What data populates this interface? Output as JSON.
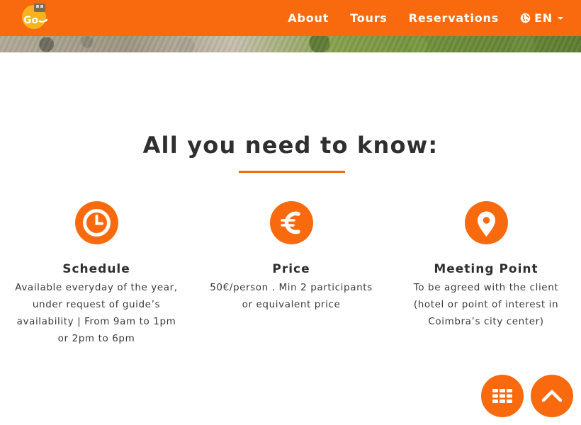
{
  "navbar": {
    "logo_text": "Go",
    "items": [
      {
        "label": "About"
      },
      {
        "label": "Tours"
      },
      {
        "label": "Reservations"
      }
    ],
    "language": {
      "label": "EN",
      "icon": "globe-icon"
    }
  },
  "section": {
    "title": "All you need to know:"
  },
  "features": [
    {
      "icon": "clock-icon",
      "title": "Schedule",
      "lines": [
        "Available everyday of the year,",
        "under request of guide’s",
        "availability | From 9am to 1pm",
        "or 2pm to 6pm"
      ]
    },
    {
      "icon": "euro-icon",
      "title": "Price",
      "lines": [
        "50€/person . Min 2 participants",
        "or equivalent price"
      ]
    },
    {
      "icon": "map-pin-icon",
      "title": "Meeting Point",
      "lines": [
        "To be agreed with the client",
        "(hotel or point of interest in",
        "Coimbra’s city center)"
      ]
    }
  ],
  "floating_buttons": {
    "menu_icon": "grid-icon",
    "top_icon": "chevron-up-icon"
  },
  "colors": {
    "accent": "#f86a0d",
    "heading": "#2f2f2f",
    "nav_text": "#ffffff"
  }
}
